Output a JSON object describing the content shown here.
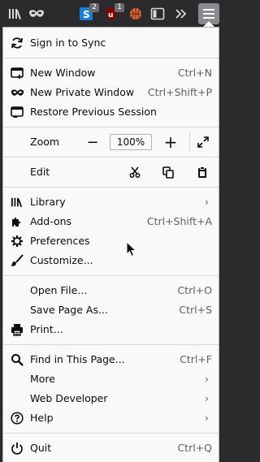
{
  "toolbar": {
    "badge_1": "2",
    "badge_2": "1"
  },
  "menu": {
    "sync": "Sign in to Sync",
    "new_window": {
      "label": "New Window",
      "shortcut": "Ctrl+N"
    },
    "new_private_window": {
      "label": "New Private Window",
      "shortcut": "Ctrl+Shift+P"
    },
    "restore_session": {
      "label": "Restore Previous Session"
    },
    "zoom": {
      "label": "Zoom",
      "minus": "−",
      "value": "100%",
      "plus": "+"
    },
    "edit": {
      "label": "Edit"
    },
    "library": {
      "label": "Library"
    },
    "addons": {
      "label": "Add-ons",
      "shortcut": "Ctrl+Shift+A"
    },
    "preferences": {
      "label": "Preferences"
    },
    "customize": {
      "label": "Customize..."
    },
    "open_file": {
      "label": "Open File...",
      "shortcut": "Ctrl+O"
    },
    "save_page": {
      "label": "Save Page As...",
      "shortcut": "Ctrl+S"
    },
    "print": {
      "label": "Print..."
    },
    "find": {
      "label": "Find in This Page...",
      "shortcut": "Ctrl+F"
    },
    "more": {
      "label": "More"
    },
    "web_developer": {
      "label": "Web Developer"
    },
    "help": {
      "label": "Help"
    },
    "quit": {
      "label": "Quit",
      "shortcut": "Ctrl+Q"
    }
  },
  "chevron": "›"
}
